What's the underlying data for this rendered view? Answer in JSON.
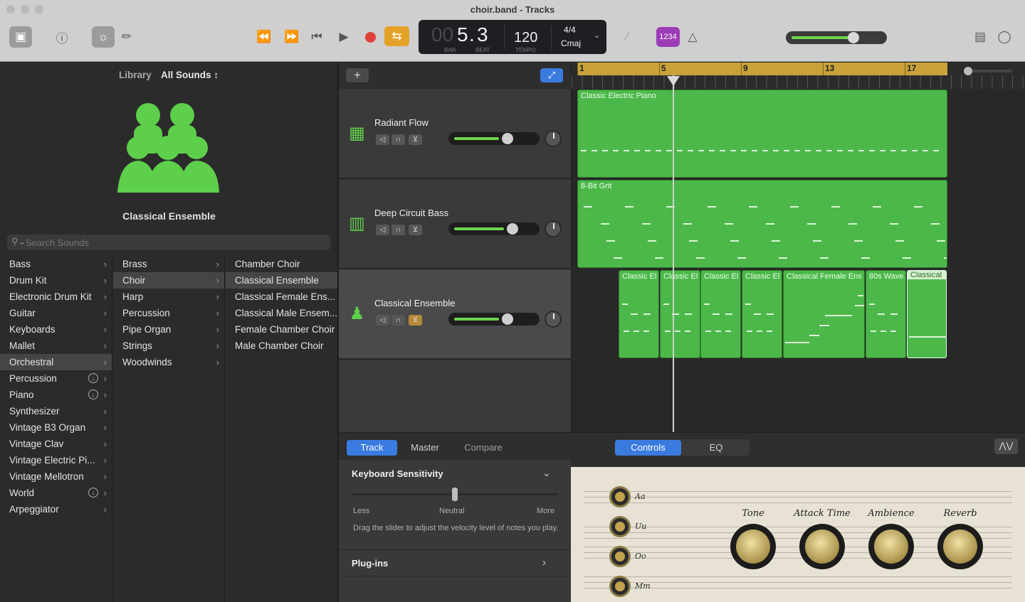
{
  "window": {
    "title": "choir.band - Tracks"
  },
  "toolbar": {
    "lcd": {
      "bar": "5",
      "beat_int": "00",
      "beat": "3",
      "bar_label": "BAR",
      "beat_label": "BEAT",
      "tempo": "120",
      "tempo_label": "TEMPO",
      "time_sig": "4/4",
      "key": "Cmaj"
    },
    "count_in": "1234",
    "master_volume": 0.68
  },
  "library": {
    "label": "Library",
    "sound_set": "All Sounds",
    "patch_name": "Classical Ensemble",
    "search_placeholder": "Search Sounds",
    "categories": [
      {
        "label": "Bass"
      },
      {
        "label": "Drum Kit"
      },
      {
        "label": "Electronic Drum Kit"
      },
      {
        "label": "Guitar"
      },
      {
        "label": "Keyboards"
      },
      {
        "label": "Mallet"
      },
      {
        "label": "Orchestral",
        "selected": true
      },
      {
        "label": "Percussion",
        "download": true
      },
      {
        "label": "Piano",
        "download": true
      },
      {
        "label": "Synthesizer"
      },
      {
        "label": "Vintage B3 Organ"
      },
      {
        "label": "Vintage Clav"
      },
      {
        "label": "Vintage Electric Pi..."
      },
      {
        "label": "Vintage Mellotron"
      },
      {
        "label": "World",
        "download": true
      },
      {
        "label": "Arpeggiator"
      }
    ],
    "subcategories": [
      {
        "label": "Brass"
      },
      {
        "label": "Choir",
        "selected": true
      },
      {
        "label": "Harp"
      },
      {
        "label": "Percussion"
      },
      {
        "label": "Pipe Organ"
      },
      {
        "label": "Strings"
      },
      {
        "label": "Woodwinds"
      }
    ],
    "patches": [
      {
        "label": "Chamber Choir"
      },
      {
        "label": "Classical Ensemble",
        "selected": true
      },
      {
        "label": "Classical Female Ens..."
      },
      {
        "label": "Classical Male Ensem..."
      },
      {
        "label": "Female Chamber Choir"
      },
      {
        "label": "Male Chamber Choir"
      }
    ]
  },
  "tracks": [
    {
      "name": "Radiant Flow",
      "volume": 0.62,
      "icon": "keyboard-icon"
    },
    {
      "name": "Deep Circuit Bass",
      "volume": 0.68,
      "icon": "synth-icon"
    },
    {
      "name": "Classical Ensemble",
      "volume": 0.62,
      "icon": "choir-icon",
      "selected": true
    }
  ],
  "ruler": {
    "bars": [
      "1",
      "5",
      "9",
      "13",
      "17"
    ]
  },
  "regions": {
    "track1": "Classic Electric Piano",
    "track2": "8-Bit Grit",
    "track3": [
      "Classic El",
      "Classic El",
      "Classic El",
      "Classic El",
      "Classical Female Ens",
      "80s Wave",
      "Classical"
    ]
  },
  "smart_controls": {
    "tabs": {
      "track": "Track",
      "master": "Master",
      "compare": "Compare"
    },
    "view_tabs": {
      "controls": "Controls",
      "eq": "EQ"
    },
    "keyboard_sensitivity": {
      "title": "Keyboard Sensitivity",
      "less": "Less",
      "neutral": "Neutral",
      "more": "More",
      "description": "Drag the slider to adjust the velocity level of notes you play.",
      "value": 0.5
    },
    "plugins": "Plug-ins",
    "amp_buttons": [
      "Aa",
      "Uu",
      "Oo",
      "Mm"
    ],
    "knobs": [
      "Tone",
      "Attack Time",
      "Ambience",
      "Reverb"
    ]
  },
  "colors": {
    "accent": "#3a7be0",
    "region": "#4cb84a",
    "loop": "#e5a229",
    "record": "#e0403a",
    "count_in": "#9c3db7"
  }
}
